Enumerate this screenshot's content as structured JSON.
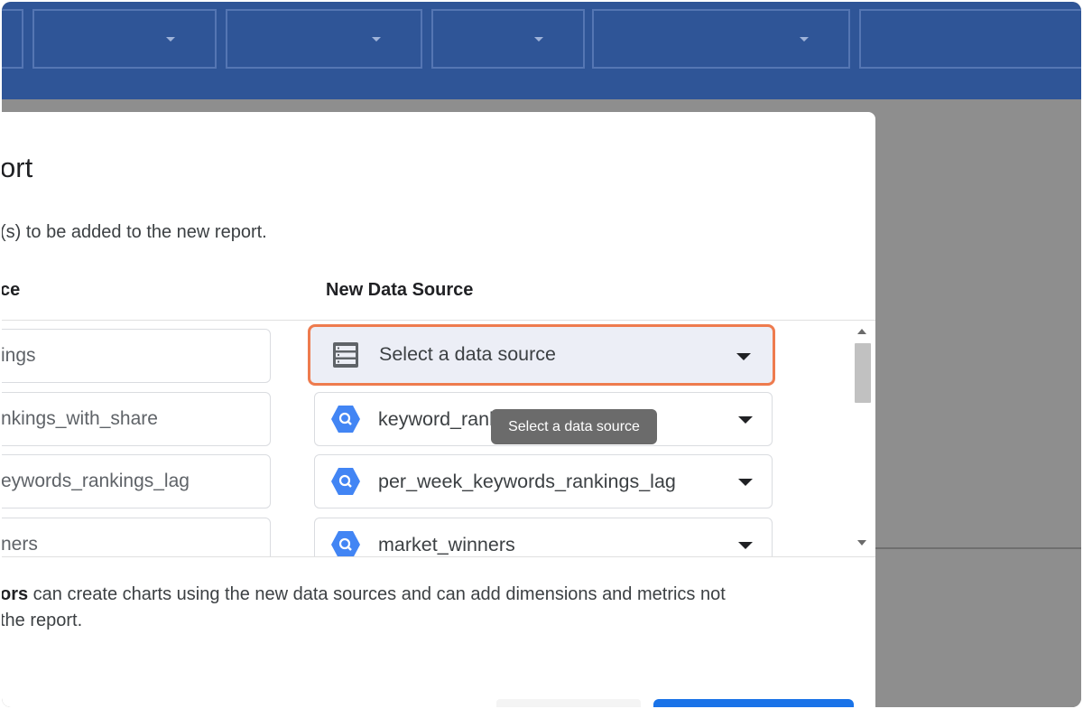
{
  "dialog": {
    "title": "ort",
    "subtitle": "(s) to be added to the new report.",
    "col_old": "ce",
    "col_new": "New Data Source",
    "footer_bold": "ors",
    "footer_line1_rest": " can create charts using the new data sources and can add dimensions and metrics not",
    "footer_line2": "the report."
  },
  "rows": [
    {
      "old": "ings",
      "new": "Select a data source",
      "icon": "data-source-list-icon",
      "selected": true
    },
    {
      "old": "nkings_with_share",
      "new": "keyword_rankings_with_share",
      "icon": "bigquery-icon",
      "selected": false
    },
    {
      "old": "eywords_rankings_lag",
      "new": "per_week_keywords_rankings_lag",
      "icon": "bigquery-icon",
      "selected": false
    },
    {
      "old": "ners",
      "new": "market_winners",
      "icon": "bigquery-icon",
      "selected": false
    }
  ],
  "tooltip": "Select a data source",
  "colors": {
    "topbar": "#2f5597",
    "highlight_border": "#ee7b4e",
    "bigquery": "#4285f4",
    "primary_button": "#1a73e8"
  }
}
